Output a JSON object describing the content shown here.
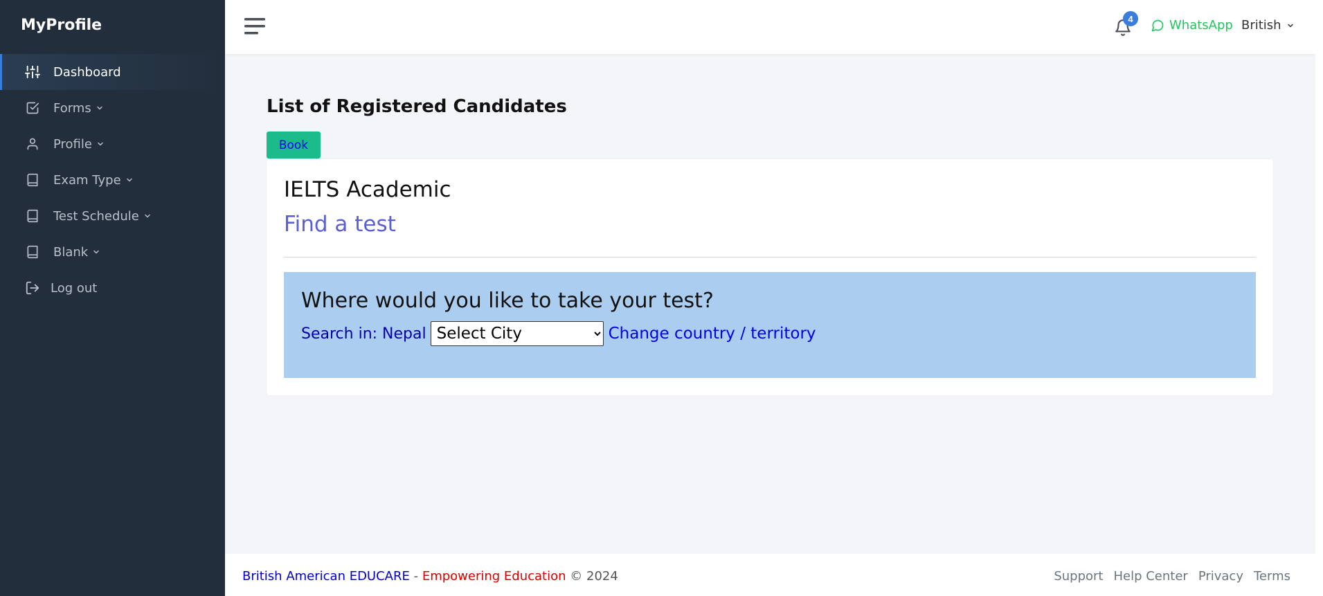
{
  "sidebar": {
    "brand": "MyProfile",
    "items": [
      {
        "label": "Dashboard",
        "icon": "sliders-icon",
        "active": true
      },
      {
        "label": "Forms",
        "icon": "check-square-icon"
      },
      {
        "label": "Profile",
        "icon": "user-icon"
      },
      {
        "label": "Exam Type",
        "icon": "book-icon"
      },
      {
        "label": "Test Schedule",
        "icon": "book-icon"
      },
      {
        "label": "Blank",
        "icon": "book-icon"
      },
      {
        "label": "Log out",
        "icon": "log-out-icon"
      }
    ]
  },
  "topbar": {
    "notification_count": "4",
    "whatsapp_label": "WhatsApp",
    "language": "British"
  },
  "main": {
    "page_title": "List of Registered Candidates",
    "book_label": "Book",
    "card": {
      "title": "IELTS Academic",
      "find_link": "Find a test",
      "search_heading": "Where would you like to take your test?",
      "search_label": "Search in: Nepal",
      "city_selected": "Select City",
      "change_link": "Change country / territory"
    }
  },
  "footer": {
    "org": "British American EDUCARE",
    "separator": " - ",
    "tagline": "Empowering Education",
    "copyright": " © 2024",
    "links": [
      "Support",
      "Help Center",
      "Privacy",
      "Terms"
    ]
  },
  "colors": {
    "sidebar_bg": "#222e3c",
    "accent": "#3b7ddd",
    "book_button": "#1cbb8c",
    "search_panel": "#abcdf0",
    "whatsapp": "#22c55e"
  }
}
